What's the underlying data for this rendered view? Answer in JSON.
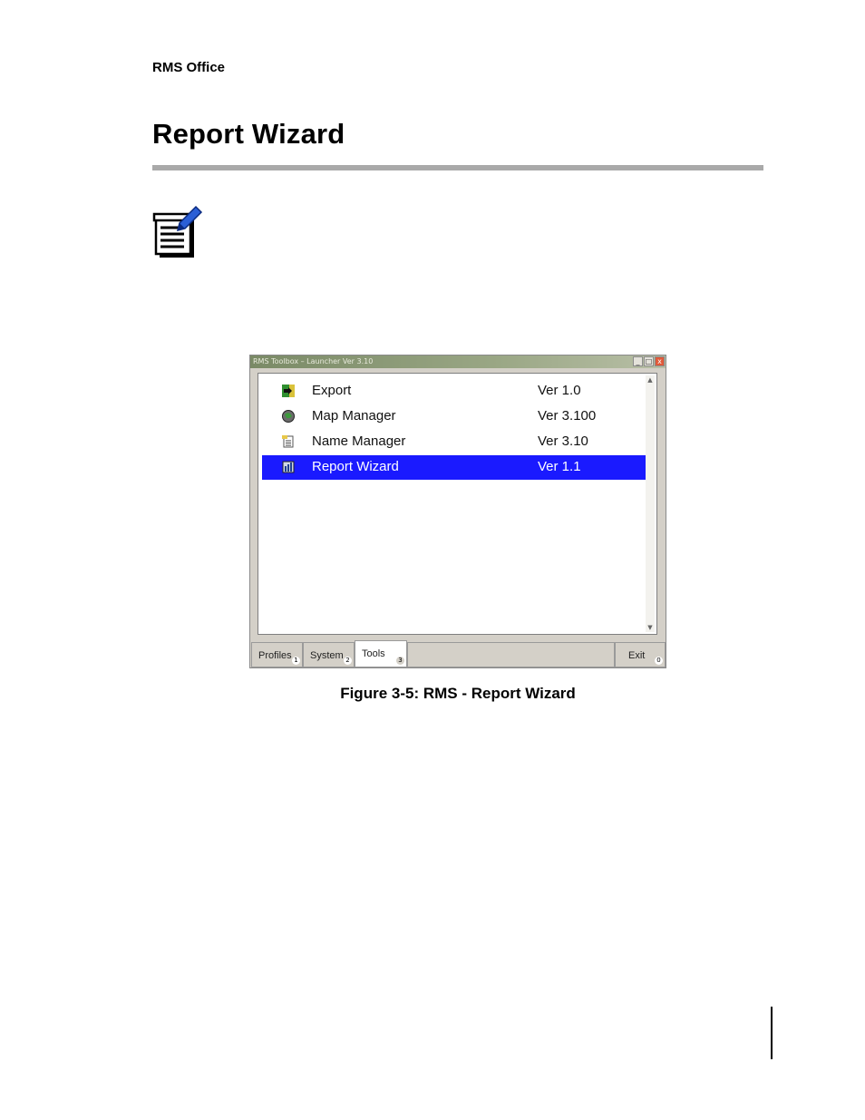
{
  "header": {
    "running_head": "RMS Office"
  },
  "section": {
    "title": "Report Wizard"
  },
  "note": {
    "icon": "note-pad-pencil-icon"
  },
  "window": {
    "title": "RMS Toolbox – Launcher Ver 3.10",
    "buttons": [
      "_",
      "□",
      "x"
    ],
    "list": [
      {
        "name": "Export",
        "version": "Ver 1.0",
        "icon": "export-icon",
        "selected": false
      },
      {
        "name": "Map Manager",
        "version": "Ver 3.100",
        "icon": "map-manager-icon",
        "selected": false
      },
      {
        "name": "Name Manager",
        "version": "Ver 3.10",
        "icon": "name-manager-icon",
        "selected": false
      },
      {
        "name": "Report Wizard",
        "version": "Ver 1.1",
        "icon": "report-wizard-icon",
        "selected": true
      }
    ],
    "tabs": [
      {
        "label": "Profiles",
        "num": "1",
        "active": false
      },
      {
        "label": "System",
        "num": "2",
        "active": false
      },
      {
        "label": "Tools",
        "num": "3",
        "active": true
      },
      {
        "label": "Exit",
        "num": "0",
        "active": false
      }
    ],
    "colors": {
      "selection": "#1a1aff",
      "chrome": "#d4d0c8"
    }
  },
  "figure": {
    "caption": "Figure 3-5: RMS - Report Wizard"
  }
}
